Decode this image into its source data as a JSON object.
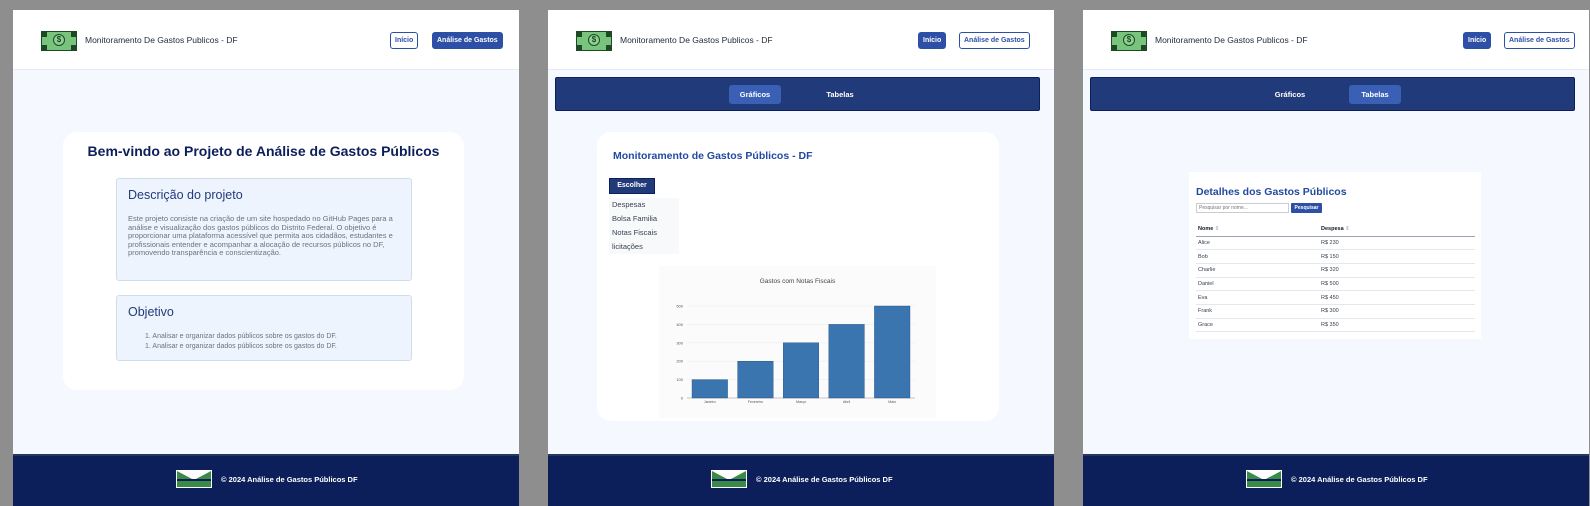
{
  "site": {
    "title": "Monitoramento De Gastos Publicos - DF",
    "nav": {
      "home": "Início",
      "analysis": "Análise de Gastos"
    },
    "footer": "© 2024 Análise de Gastos Públicos DF",
    "money_symbol": "$"
  },
  "home": {
    "heading": "Bem-vindo ao Projeto de Análise de Gastos Públicos",
    "description_title": "Descrição do projeto",
    "description_text": "Este projeto consiste na criação de um site hospedado no GitHub Pages para a análise e visualização dos gastos públicos do Distrito Federal. O objetivo é proporcionar uma plataforma acessível que permita aos cidadãos, estudantes e profissionais entender e acompanhar a alocação de recursos públicos no DF, promovendo transparência e conscientização.",
    "objective_title": "Objetivo",
    "objectives": [
      "1. Analisar e organizar dados públicos sobre os gastos do DF.",
      "1. Analisar e organizar dados públicos sobre os gastos do DF."
    ]
  },
  "analysis": {
    "tabs": [
      "Gráficos",
      "Tabelas"
    ],
    "card_title": "Monitoramento de Gastos Públicos - DF",
    "choose_label": "Escolher",
    "options": [
      "Despesas",
      "Bolsa Familia",
      "Notas Fiscais",
      "licitações"
    ]
  },
  "chart_data": {
    "type": "bar",
    "title": "Gastos com Notas Fiscais",
    "categories": [
      "Janeiro",
      "Fevereiro",
      "Março",
      "Abril",
      "Maio"
    ],
    "values": [
      100,
      200,
      300,
      400,
      500
    ],
    "yticks": [
      0,
      100,
      200,
      300,
      400,
      500
    ],
    "ylim": [
      0,
      500
    ],
    "bar_color": "#3a75b0",
    "grid": true
  },
  "table": {
    "title": "Detalhes dos Gastos Públicos",
    "search_placeholder": "Pesquisar por nome...",
    "search_button": "Pesquisar",
    "columns": [
      "Nome",
      "Despesa"
    ],
    "sort_icon": "⇕",
    "rows": [
      [
        "Alice",
        "R$ 230"
      ],
      [
        "Bob",
        "R$ 150"
      ],
      [
        "Charlie",
        "R$ 320"
      ],
      [
        "Daniel",
        "R$ 500"
      ],
      [
        "Eva",
        "R$ 450"
      ],
      [
        "Frank",
        "R$ 300"
      ],
      [
        "Grace",
        "R$ 350"
      ]
    ]
  },
  "colors": {
    "primary": "#2d4fa5",
    "navy": "#0d1f5a",
    "tab_bar": "#213a7a",
    "page_bg": "#f5f8fe"
  }
}
